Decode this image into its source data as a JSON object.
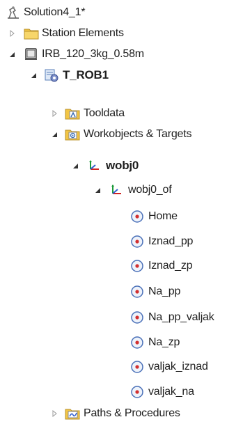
{
  "tree": {
    "solution": "Solution4_1*",
    "station_elements": "Station Elements",
    "robot": "IRB_120_3kg_0.58m",
    "task": "T_ROB1",
    "tooldata": "Tooldata",
    "workobjects": "Workobjects & Targets",
    "wobj": "wobj0",
    "wobj_of": "wobj0_of",
    "targets": [
      "Home",
      "Iznad_pp",
      "Iznad_zp",
      "Na_pp",
      "Na_pp_valjak",
      "Na_zp",
      "valjak_iznad",
      "valjak_na"
    ],
    "paths": "Paths & Procedures"
  }
}
